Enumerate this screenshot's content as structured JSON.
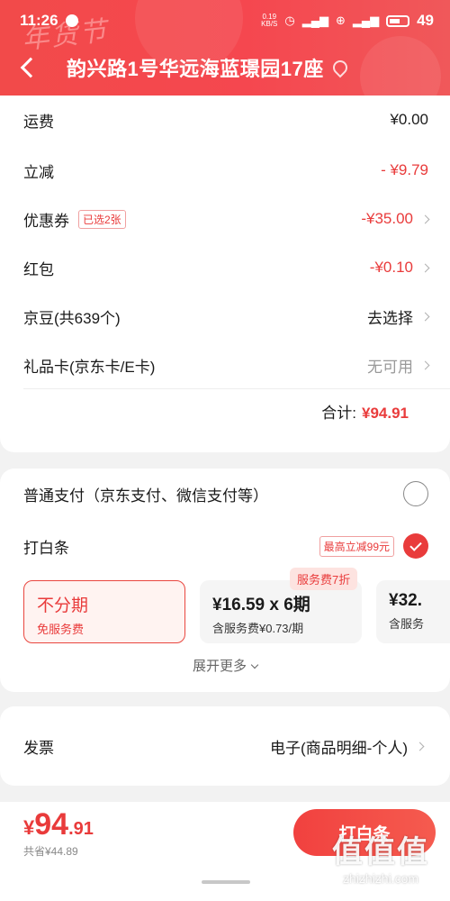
{
  "status_bar": {
    "time": "11:26",
    "net_speed_top": "0.19",
    "net_speed_bottom": "KB/S",
    "battery": "49"
  },
  "header": {
    "festival": "年货节",
    "address": "韵兴路1号华远海蓝璟园17座"
  },
  "fees": {
    "freight": {
      "label": "运费",
      "value": "¥0.00"
    },
    "discount": {
      "label": "立减",
      "value": "- ¥9.79"
    },
    "coupon": {
      "label": "优惠券",
      "tag": "已选2张",
      "value": "-¥35.00"
    },
    "red_packet": {
      "label": "红包",
      "value": "-¥0.10"
    },
    "jd_beans": {
      "label": "京豆(共639个)",
      "value": "去选择"
    },
    "gift_card": {
      "label": "礼品卡(京东卡/E卡)",
      "value": "无可用"
    },
    "total_label": "合计:",
    "total_value": "¥94.91"
  },
  "payment": {
    "normal": {
      "label": "普通支付（京东支付、微信支付等）"
    },
    "baitiao": {
      "label": "打白条",
      "promo": "最高立减99元"
    },
    "fee_badge": "服务费7折",
    "plans": [
      {
        "title": "不分期",
        "sub": "免服务费"
      },
      {
        "title": "¥16.59 x 6期",
        "sub": "含服务费¥0.73/期"
      },
      {
        "title": "¥32.",
        "sub": "含服务"
      }
    ],
    "more": "展开更多"
  },
  "invoice": {
    "label": "发票",
    "value": "电子(商品明细-个人)"
  },
  "bottom_bar": {
    "currency": "¥",
    "price_int": "94",
    "price_dec": ".91",
    "saved": "共省¥44.89",
    "pay_button": "打白条"
  },
  "watermark": {
    "main": "值值值",
    "site": "zhizhizhi.com"
  },
  "colors": {
    "accent": "#e93b3b",
    "header": "#f24a4a"
  }
}
